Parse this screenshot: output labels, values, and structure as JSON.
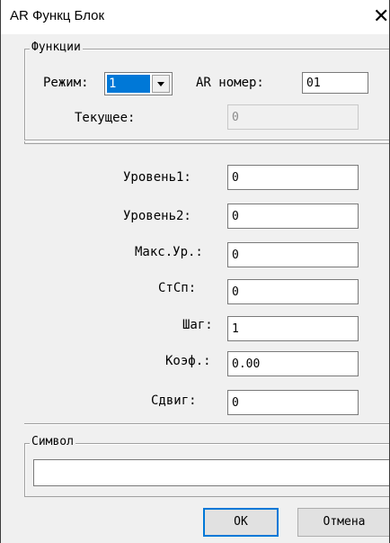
{
  "window": {
    "title": "AR Функц Блок",
    "close_glyph": "✕"
  },
  "functions": {
    "legend": "Функции",
    "mode_label": "Режим:",
    "mode_value": "1",
    "ar_number_label": "AR номер:",
    "ar_number_value": "01",
    "current_label": "Текущее:",
    "current_value": "0"
  },
  "params": [
    {
      "label": "Уровень1:",
      "value": "0"
    },
    {
      "label": "Уровень2:",
      "value": "0"
    },
    {
      "label": "Макс.Ур.:",
      "value": "0"
    },
    {
      "label": "СтСп:",
      "value": "0"
    },
    {
      "label": "Шаг:",
      "value": "1"
    },
    {
      "label": "Коэф.:",
      "value": "0.00"
    },
    {
      "label": "Сдвиг:",
      "value": "0"
    }
  ],
  "symbol": {
    "legend": "Символ",
    "value": ""
  },
  "buttons": {
    "ok": "ОК",
    "cancel": "Отмена"
  },
  "colors": {
    "selection": "#0078d7",
    "face": "#f0f0f0"
  },
  "icons": {
    "close": "close-icon",
    "dropdown": "chevron-down-icon"
  }
}
